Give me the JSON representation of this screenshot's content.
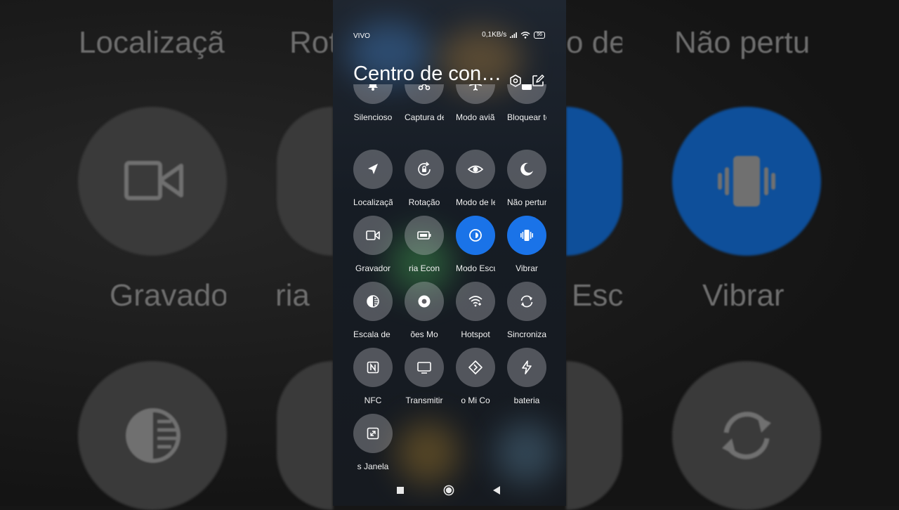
{
  "status_bar": {
    "carrier": "VIVO",
    "speed": "0,1KB/s",
    "battery": "96"
  },
  "control_center": {
    "title": "Centro de controle",
    "tiles": [
      {
        "label": "Silencioso",
        "icon": "bell-icon",
        "active": false
      },
      {
        "label": "Captura de tela",
        "icon": "scissors-icon",
        "active": false
      },
      {
        "label": "Modo avião",
        "icon": "airplane-icon",
        "active": false
      },
      {
        "label": "Bloquear tela",
        "icon": "lock-icon",
        "active": false
      },
      {
        "label": "Localização",
        "icon": "location-arrow-icon",
        "active": false
      },
      {
        "label": "Rotação",
        "icon": "rotation-lock-icon",
        "active": false
      },
      {
        "label": "Modo de leitura",
        "icon": "eye-icon",
        "active": false
      },
      {
        "label": "Não perturbe",
        "icon": "moon-icon",
        "active": false
      },
      {
        "label": "Gravador",
        "icon": "video-camera-icon",
        "active": false
      },
      {
        "label": "ria   Econ",
        "icon": "battery-saver-icon",
        "active": false
      },
      {
        "label": "Modo Escuro",
        "icon": "dark-mode-icon",
        "active": true
      },
      {
        "label": "Vibrar",
        "icon": "vibrate-icon",
        "active": true
      },
      {
        "label": "Escala de cinza",
        "icon": "grayscale-icon",
        "active": false
      },
      {
        "label": "ões   Mo",
        "icon": "record-dot-icon",
        "active": false
      },
      {
        "label": "Hotspot",
        "icon": "hotspot-icon",
        "active": false
      },
      {
        "label": "Sincronizar",
        "icon": "sync-icon",
        "active": false
      },
      {
        "label": "NFC",
        "icon": "nfc-icon",
        "active": false
      },
      {
        "label": "Transmitir",
        "icon": "cast-screen-icon",
        "active": false
      },
      {
        "label": "o Mi   Co",
        "icon": "mi-share-icon",
        "active": false
      },
      {
        "label": "bateria",
        "icon": "lightning-icon",
        "active": false
      },
      {
        "label": "s   Janela",
        "icon": "floating-window-icon",
        "active": false
      }
    ]
  },
  "background": {
    "labels": [
      "Localizaçã",
      "Rot",
      "o de",
      "Não pertu",
      "Gravado",
      "ria",
      "Esc",
      "Vibrar"
    ]
  },
  "colors": {
    "accent": "#1a73e8",
    "tile_off": "#5e5e63",
    "text": "#ffffff"
  }
}
